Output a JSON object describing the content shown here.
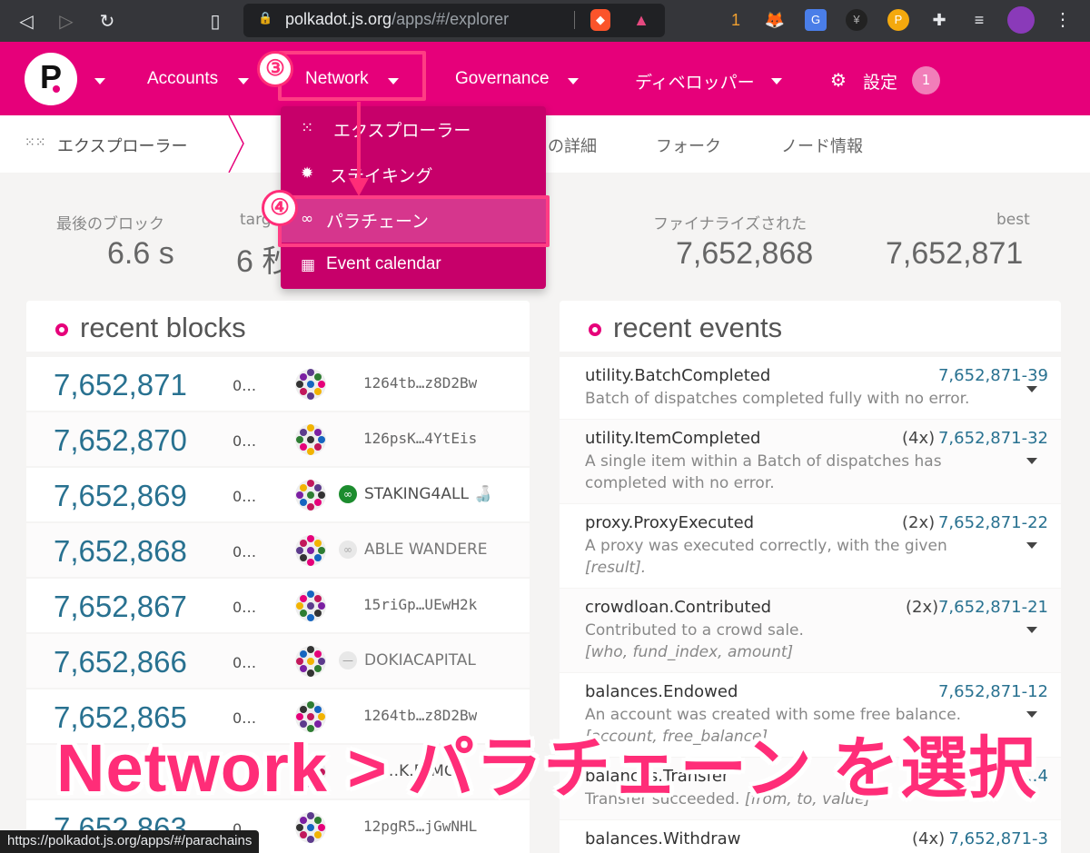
{
  "browser": {
    "url_host": "polkadot.js.org",
    "url_path": "/apps/#/explorer",
    "extension_badge": "1"
  },
  "header": {
    "nav": [
      {
        "label": "Accounts"
      },
      {
        "label": "Network"
      },
      {
        "label": "Governance"
      },
      {
        "label": "ディベロッパー"
      },
      {
        "label": "設定"
      }
    ],
    "settings_badge": "1",
    "brand_color": "#e6007a"
  },
  "tabs": {
    "active": "エクスプローラー",
    "items": [
      "の詳細",
      "フォーク",
      "ノード情報"
    ]
  },
  "dropdown": {
    "items": [
      {
        "label": "エクスプローラー",
        "icon": "grid-icon"
      },
      {
        "label": "ステイキング",
        "icon": "gear-icon"
      },
      {
        "label": "パラチェーン",
        "icon": "link-icon"
      },
      {
        "label": "Event calendar",
        "icon": "calendar-icon"
      }
    ]
  },
  "summary": {
    "last_block_label": "最後のブロック",
    "last_block_value": "6.6 s",
    "target_label": "targ",
    "target_value": "6 秒",
    "finalized_label": "ファイナライズされた",
    "finalized_value": "7,652,868",
    "best_label": "best",
    "best_value": "7,652,871"
  },
  "recent_blocks": {
    "title": "recent blocks",
    "rows": [
      {
        "number": "7,652,871",
        "time": "0…",
        "author": "1264tb…z8D2Bw",
        "mono": true
      },
      {
        "number": "7,652,870",
        "time": "0…",
        "author": "126psK…4YtEis",
        "mono": true
      },
      {
        "number": "7,652,869",
        "time": "0…",
        "author": "STAKING4ALL 🍶",
        "mono": false,
        "icon": "link-icon"
      },
      {
        "number": "7,652,868",
        "time": "0…",
        "author": "ABLE WANDERE",
        "mono": false,
        "icon": "link-icon"
      },
      {
        "number": "7,652,867",
        "time": "0…",
        "author": "15riGp…UEwH2k",
        "mono": true
      },
      {
        "number": "7,652,866",
        "time": "0…",
        "author": "DOKIACAPITAL",
        "mono": false,
        "icon": "minus-icon"
      },
      {
        "number": "7,652,865",
        "time": "0…",
        "author": "1264tb…z8D2Bw",
        "mono": true
      },
      {
        "number": "",
        "time": "",
        "author": "BL…K.D.MC",
        "mono": false
      },
      {
        "number": "7,652,863",
        "time": "0…",
        "author": "12pgR5…jGwNHL",
        "mono": true
      }
    ]
  },
  "recent_events": {
    "title": "recent events",
    "rows": [
      {
        "name": "utility.BatchCompleted",
        "count": "",
        "link": "7,652,871-39",
        "desc": "Batch of dispatches completed fully with no error.",
        "params": ""
      },
      {
        "name": "utility.ItemCompleted",
        "count": "(4x)",
        "link": "7,652,871-32",
        "desc": "A single item within a Batch of dispatches has completed with no error.",
        "params": ""
      },
      {
        "name": "proxy.ProxyExecuted",
        "count": "(2x)",
        "link": "7,652,871-22",
        "desc": "A proxy was executed correctly, with the given",
        "params": "[result]."
      },
      {
        "name": "crowdloan.Contributed",
        "count": "(2x)",
        "link": "7,652,871-21",
        "desc": "Contributed to a crowd sale.",
        "params": "[who, fund_index, amount]"
      },
      {
        "name": "balances.Endowed",
        "count": "",
        "link": "7,652,871-12",
        "desc": "An account was created with some free balance.",
        "params": "[account, free_balance]"
      },
      {
        "name": "balances.Transfer",
        "count": "",
        "link": "…4",
        "desc": "Transfer succeeded.",
        "params": "[from, to, value]"
      },
      {
        "name": "balances.Withdraw",
        "count": "(4x)",
        "link": "7,652,871-3",
        "desc": "",
        "params": ""
      }
    ]
  },
  "annotations": {
    "step3": "③",
    "step4": "④",
    "caption": "Network > パラチェーン を選択"
  },
  "status_url": "https://polkadot.js.org/apps/#/parachains"
}
